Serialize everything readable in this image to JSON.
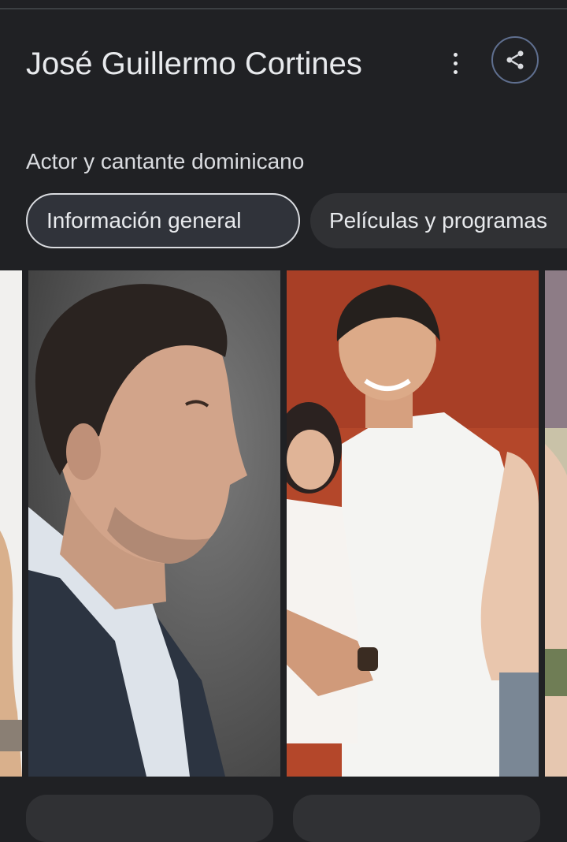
{
  "header": {
    "title": "José Guillermo Cortines",
    "subtitle": "Actor y cantante dominicano"
  },
  "actions": {
    "more_icon": "more-vert-icon",
    "share_icon": "share-icon"
  },
  "tabs": [
    {
      "label": "Información general",
      "selected": true
    },
    {
      "label": "Películas y programas",
      "selected": false
    }
  ],
  "colors": {
    "background": "#202124",
    "chip_inactive": "#303134",
    "share_ring": "#5f6f8f"
  }
}
